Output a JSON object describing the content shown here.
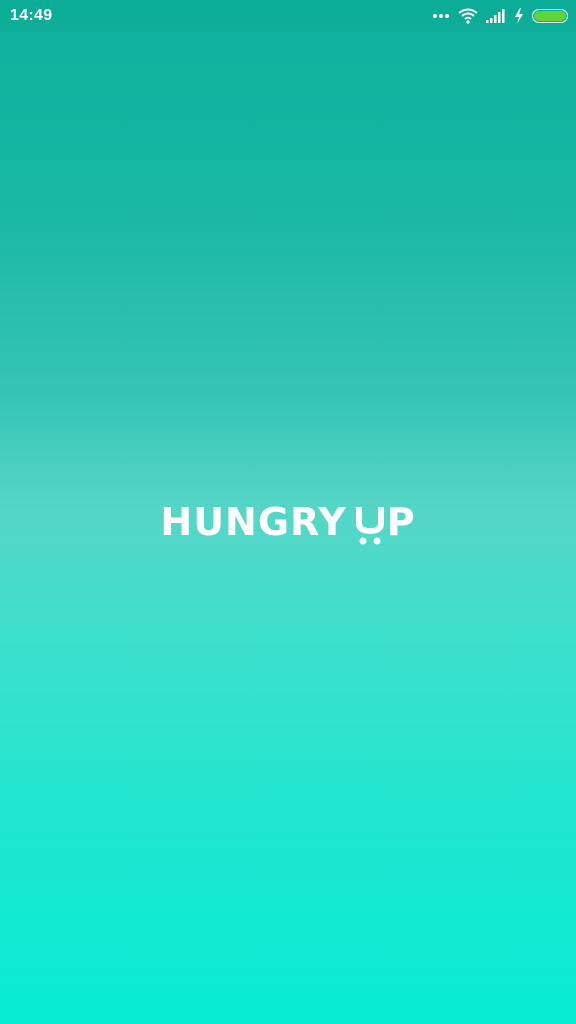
{
  "status_bar": {
    "time": "14:49",
    "icons": [
      "more-dots-icon",
      "wifi-icon",
      "signal-icon",
      "charging-icon",
      "battery-icon"
    ],
    "battery_color": "#5fd43a"
  },
  "splash": {
    "logo_word_1": "HUNGRY",
    "logo_word_2_rest": "P",
    "logo_cart_letter": "U"
  },
  "colors": {
    "gradient_top": "#0fb29e",
    "gradient_mid": "#55d6c7",
    "gradient_bottom": "#06edd2",
    "text": "#ffffff"
  }
}
